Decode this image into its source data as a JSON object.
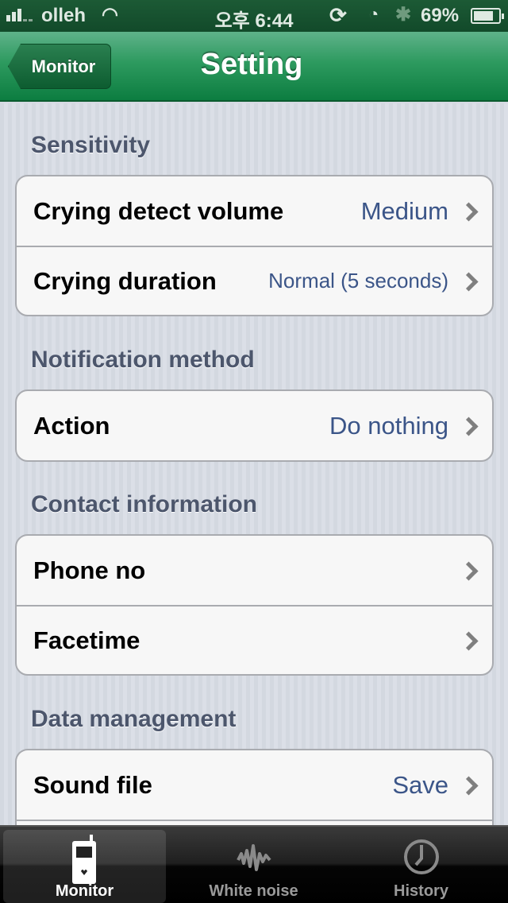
{
  "status_bar": {
    "carrier": "olleh",
    "time": "오후 6:44",
    "battery_percent": "69%",
    "icons": [
      "signal-icon",
      "wifi-icon",
      "rotation-lock-icon",
      "alarm-icon",
      "bluetooth-icon",
      "battery-charging-icon"
    ]
  },
  "nav": {
    "back_label": "Monitor",
    "title": "Setting"
  },
  "sections": [
    {
      "header": "Sensitivity",
      "rows": [
        {
          "label": "Crying detect volume",
          "value": "Medium"
        },
        {
          "label": "Crying duration",
          "value": "Normal (5 seconds)"
        }
      ]
    },
    {
      "header": "Notification method",
      "rows": [
        {
          "label": "Action",
          "value": "Do nothing"
        }
      ]
    },
    {
      "header": "Contact information",
      "rows": [
        {
          "label": "Phone no",
          "value": ""
        },
        {
          "label": "Facetime",
          "value": ""
        }
      ]
    },
    {
      "header": "Data management",
      "rows": [
        {
          "label": "Sound file",
          "value": "Save"
        }
      ]
    }
  ],
  "tabs": [
    {
      "label": "Monitor",
      "icon": "phone-heart-icon",
      "active": true
    },
    {
      "label": "White noise",
      "icon": "waveform-icon",
      "active": false
    },
    {
      "label": "History",
      "icon": "clock-icon",
      "active": false
    }
  ]
}
